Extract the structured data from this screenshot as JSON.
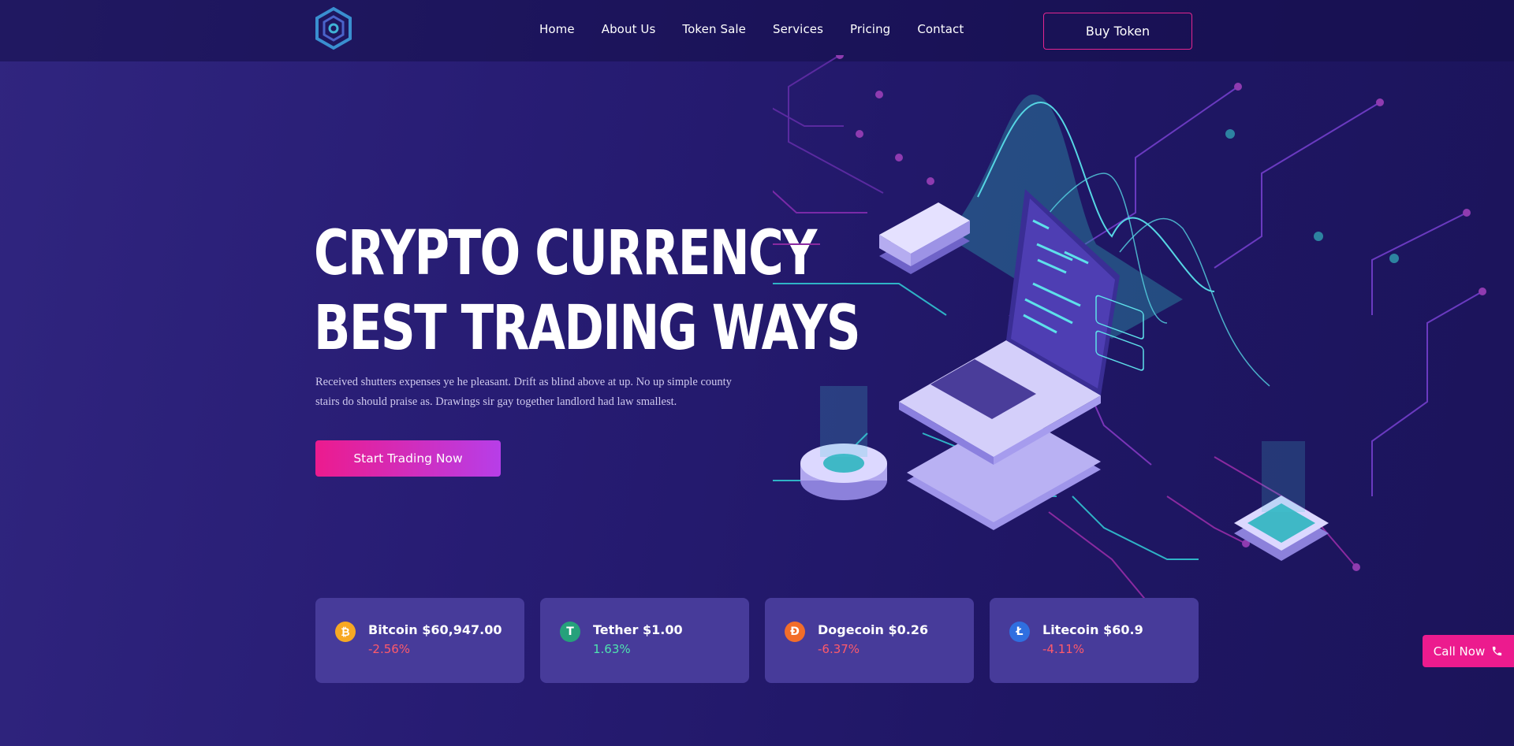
{
  "nav": {
    "items": [
      "Home",
      "About Us",
      "Token Sale",
      "Services",
      "Pricing",
      "Contact"
    ],
    "buy_label": "Buy Token"
  },
  "hero": {
    "title_line1": "CRYPTO CURRENCY",
    "title_line2": "BEST TRADING WAYS",
    "text": "Received shutters expenses ye he pleasant. Drift as blind above at up. No up simple county stairs do should praise as. Drawings sir gay together landlord had law smallest.",
    "cta_label": "Start Trading Now"
  },
  "coins": [
    {
      "symbol": "₿",
      "icon": "bitcoin-icon",
      "color": "#f7a823",
      "name": "Bitcoin $60,947.00",
      "change": "-2.56%",
      "trend": "down"
    },
    {
      "symbol": "T",
      "icon": "tether-icon",
      "color": "#26a17b",
      "name": "Tether $1.00",
      "change": "1.63%",
      "trend": "up"
    },
    {
      "symbol": "Ð",
      "icon": "dogecoin-icon",
      "color": "#f26d2a",
      "name": "Dogecoin $0.26",
      "change": "-6.37%",
      "trend": "down"
    },
    {
      "symbol": "Ł",
      "icon": "litecoin-icon",
      "color": "#2f6fe0",
      "name": "Litecoin $60.9",
      "change": "-4.11%",
      "trend": "down"
    }
  ],
  "call": {
    "label": "Call Now"
  }
}
